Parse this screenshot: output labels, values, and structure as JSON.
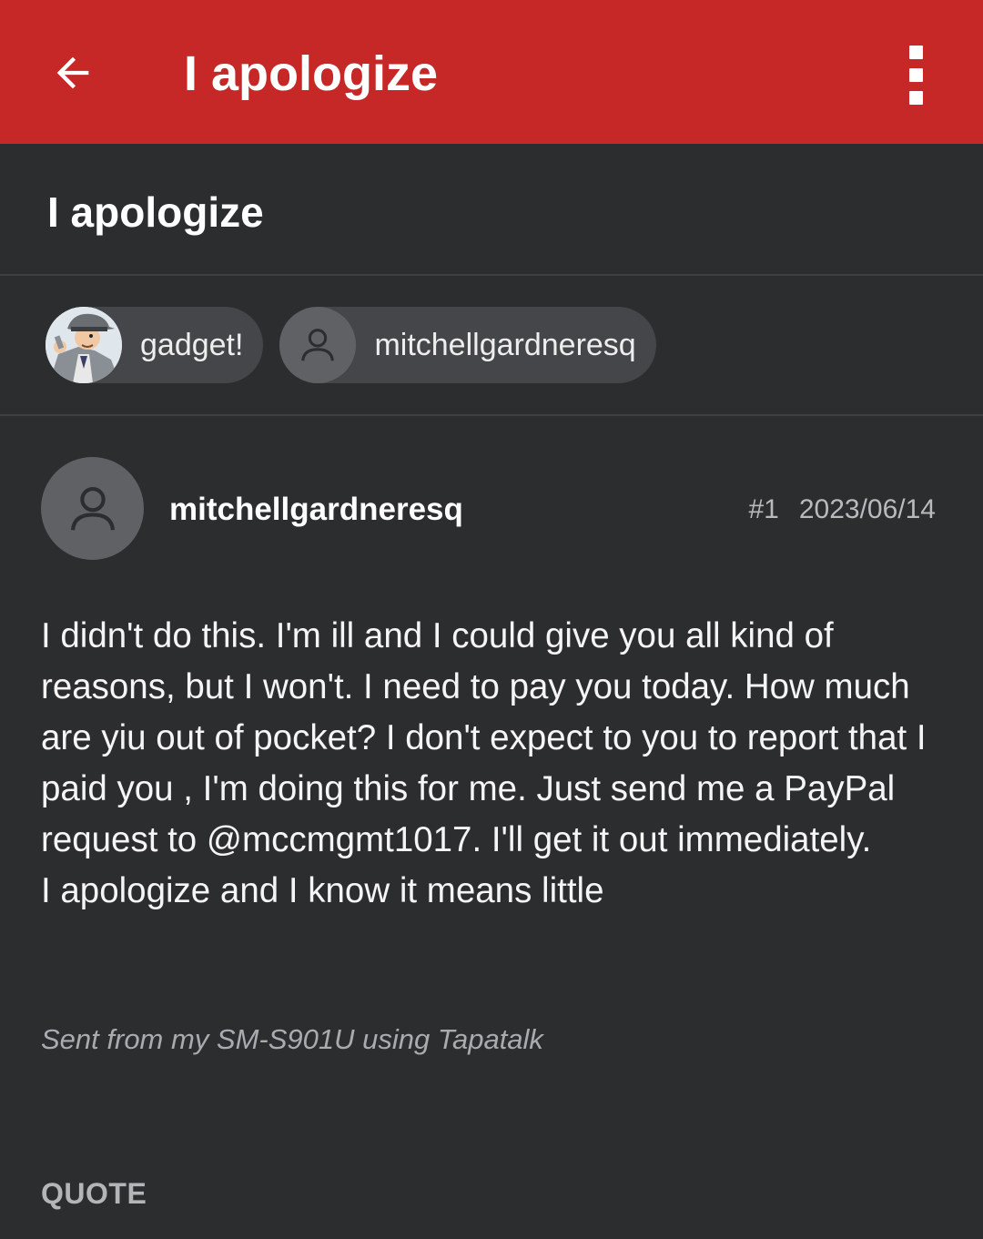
{
  "appbar": {
    "title": "I apologize",
    "back_icon": "arrow-left-icon",
    "menu_icon": "more-vertical-icon",
    "color": "#c62828"
  },
  "topic": {
    "title": "I apologize"
  },
  "participants": [
    {
      "name": "gadget!",
      "avatar": "inspector-gadget-avatar"
    },
    {
      "name": "mitchellgardneresq",
      "avatar": "person-icon"
    }
  ],
  "post": {
    "author": "mitchellgardneresq",
    "number": "#1",
    "date": "2023/06/14",
    "body_paragraph_1": "I didn't do this. I'm ill and I could give you all kind of reasons, but I won't. I need to pay you today. How much are yiu out of pocket? I don't expect to you to report that I paid you , I'm doing this for me. Just send me a PayPal request to @mccmgmt1017. I'll get it out immediately.",
    "body_paragraph_2": "I apologize and I know it means little",
    "signature": "Sent from my SM-S901U using Tapatalk",
    "quote_label": "QUOTE"
  }
}
